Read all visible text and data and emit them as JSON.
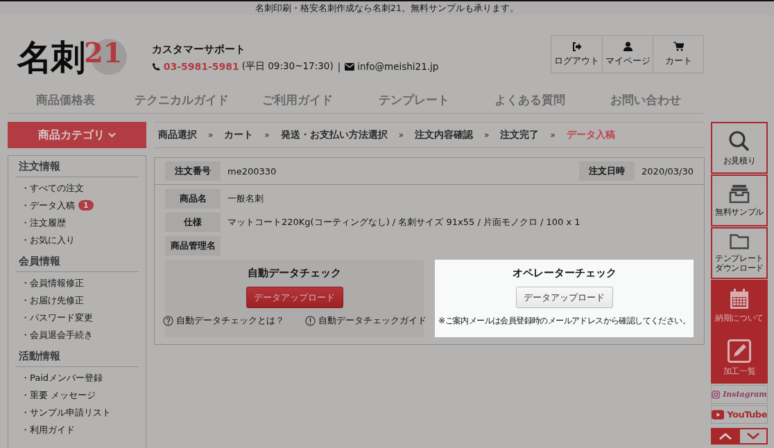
{
  "top_banner": "名刺印刷・格安名刺作成なら名刺21。無料サンプルも承ります。",
  "logo": {
    "text": "名刺",
    "accent": "21"
  },
  "support": {
    "title": "カスタマーサポート",
    "phone": "03-5981-5981",
    "hours": "(平日 09:30~17:30)",
    "separator": "|",
    "email": "info@meishi21.jp"
  },
  "header_buttons": [
    {
      "label": "ログアウト",
      "kind": "logout"
    },
    {
      "label": "マイページ",
      "kind": "user"
    },
    {
      "label": "カート",
      "kind": "cart"
    }
  ],
  "nav": [
    "商品価格表",
    "テクニカルガイド",
    "ご利用ガイド",
    "テンプレート",
    "よくある質問",
    "お問い合わせ"
  ],
  "category_button": "商品カテゴリ",
  "sidebar": [
    {
      "title": "注文情報",
      "items": [
        {
          "label": "・すべての注文"
        },
        {
          "label": "・データ入稿",
          "badge": "1"
        },
        {
          "label": "・注文履歴"
        },
        {
          "label": "・お気に入り"
        }
      ]
    },
    {
      "title": "会員情報",
      "items": [
        {
          "label": "・会員情報修正"
        },
        {
          "label": "・お届け先修正"
        },
        {
          "label": "・パスワード変更"
        },
        {
          "label": "・会員退会手続き"
        }
      ]
    },
    {
      "title": "活動情報",
      "items": [
        {
          "label": "・Paidメンバー登録"
        },
        {
          "label": "・重要 メッセージ"
        },
        {
          "label": "・サンプル申請リスト"
        },
        {
          "label": "・利用ガイド"
        }
      ]
    }
  ],
  "breadcrumb": {
    "separator": "»",
    "steps": [
      {
        "label": "商品選択",
        "selected": false
      },
      {
        "label": "カート",
        "selected": false
      },
      {
        "label": "発送・お支払い方法選択",
        "selected": false
      },
      {
        "label": "注文内容確認",
        "selected": false
      },
      {
        "label": "注文完了",
        "selected": false
      },
      {
        "label": "データ入稿",
        "selected": true
      }
    ]
  },
  "order": {
    "number_label": "注文番号",
    "number": "me200330",
    "date_label": "注文日時",
    "date": "2020/03/30",
    "rows": [
      {
        "label": "商品名",
        "value": "一般名刺"
      },
      {
        "label": "仕様",
        "value": "マットコート220Kg(コーティングなし) / 名刺サイズ 91x55 / 片面モノクロ / 100 x 1"
      },
      {
        "label": "商品管理名"
      }
    ],
    "checks": [
      {
        "title": "自動データチェック",
        "button": "データアップロード",
        "highlighted": false,
        "links": [
          {
            "label": "自動データチェックとは？",
            "kind": "question"
          },
          {
            "label": "自動データチェックガイド",
            "kind": "exclamation"
          }
        ]
      },
      {
        "title": "オペレーターチェック",
        "button": "データアップロード",
        "highlighted": true,
        "note": "※ご案内メールは会員登録時のメールアドレスから確認してください。"
      }
    ]
  },
  "side_rail": [
    {
      "lines": [
        "お見積り"
      ],
      "kind": "outline"
    },
    {
      "lines": [
        "無料サンプル"
      ],
      "kind": "outline"
    },
    {
      "lines": [
        "テンプレート",
        "ダウンロード"
      ],
      "kind": "outline"
    },
    {
      "lines": [
        "納期について"
      ],
      "kind": "filled"
    },
    {
      "lines": [
        "加工一覧"
      ],
      "kind": "filled"
    }
  ],
  "social": [
    {
      "label": "Instagram",
      "kind": "instagram"
    },
    {
      "label": "YouTube",
      "kind": "youtube"
    }
  ]
}
